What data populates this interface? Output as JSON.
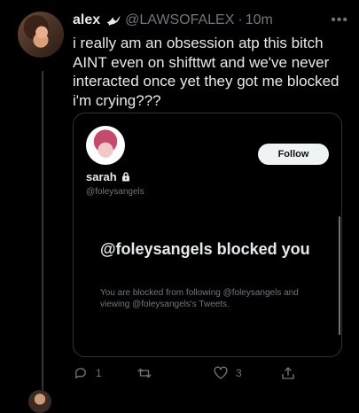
{
  "tweet": {
    "display_name": "alex",
    "badge_icon": "dove-icon",
    "handle": "@LAWSOFALEX",
    "separator": "·",
    "time": "10m",
    "more_icon": "•••",
    "text": "i really am an obsession atp this bitch AINT even on shifttwt and we've never interacted once yet they got me blocked i'm crying???"
  },
  "blocked_card": {
    "name": "sarah",
    "lock_icon": "lock-icon",
    "handle": "@foleysangels",
    "follow_label": "Follow",
    "title": "@foleysangels blocked you",
    "description": "You are blocked from following @foleysangels and viewing @foleysangels's Tweets."
  },
  "actions": {
    "reply_count": "1",
    "retweet_count": "",
    "like_count": "3",
    "share_count": ""
  },
  "colors": {
    "background": "#000000",
    "primary_text": "#e7e9ea",
    "secondary_text": "#71767b",
    "border": "#2f3336",
    "follow_bg": "#eff3f4"
  }
}
